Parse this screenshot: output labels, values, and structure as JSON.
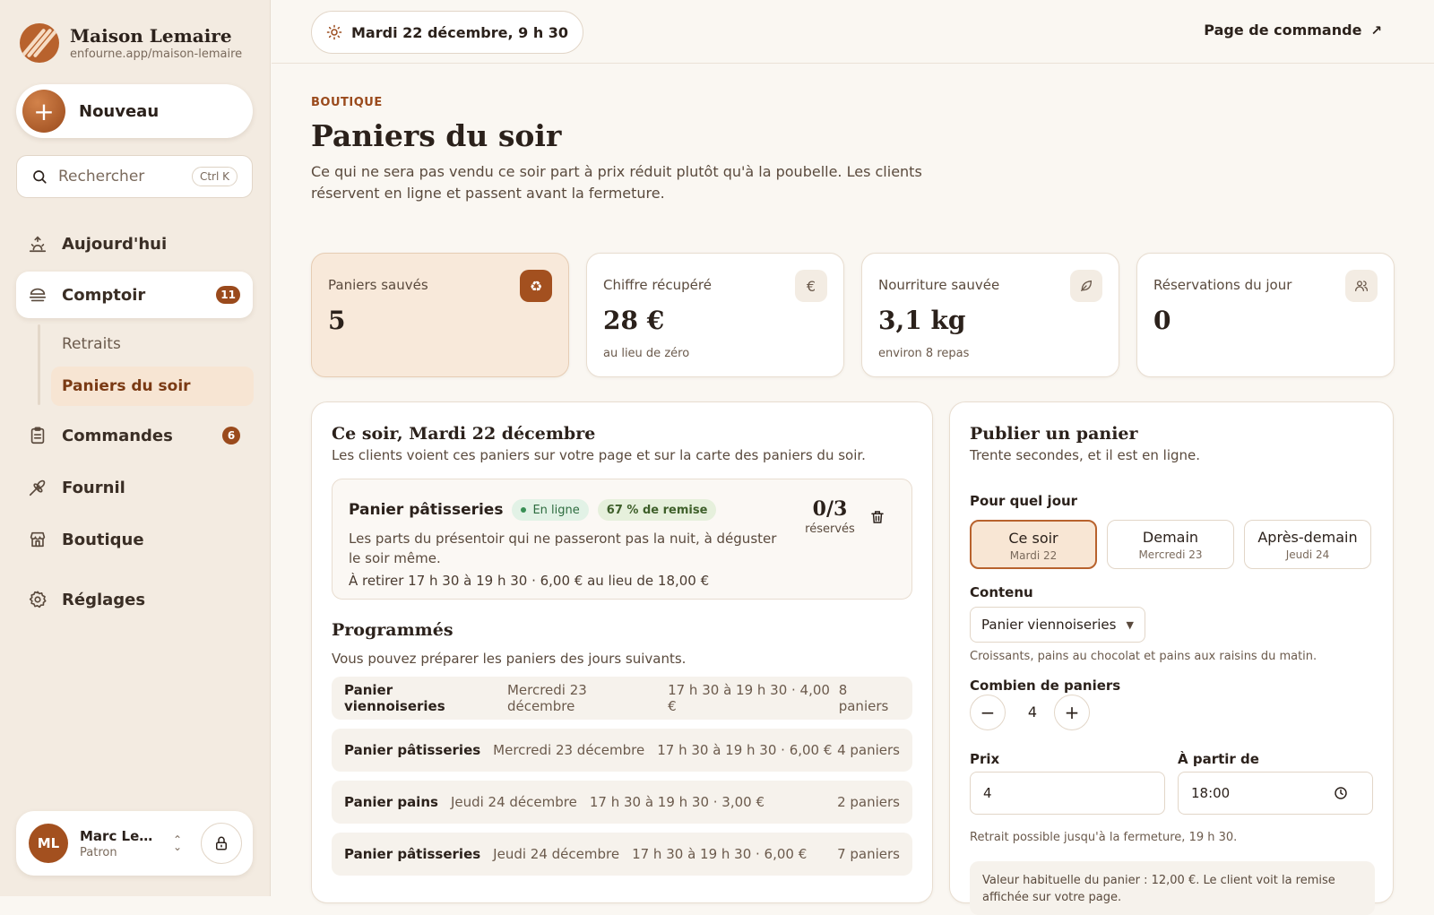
{
  "brand": {
    "name": "Maison Lemaire",
    "url": "enfourne.app/maison-lemaire"
  },
  "sidebar": {
    "new_label": "Nouveau",
    "search_placeholder": "Rechercher",
    "search_shortcut": "Ctrl K",
    "items": [
      {
        "label": "Aujourd'hui",
        "icon": "sunrise-icon"
      },
      {
        "label": "Comptoir",
        "icon": "counter-icon",
        "badge": "11"
      },
      {
        "label": "Commandes",
        "icon": "clipboard-icon",
        "badge": "6"
      },
      {
        "label": "Fournil",
        "icon": "wheat-icon"
      },
      {
        "label": "Boutique",
        "icon": "store-icon"
      },
      {
        "label": "Réglages",
        "icon": "gear-icon"
      }
    ],
    "subitems": [
      "Retraits",
      "Paniers du soir"
    ],
    "user": {
      "initials": "ML",
      "name": "Marc Lem...",
      "role": "Patron"
    }
  },
  "topbar": {
    "date": "Mardi 22 décembre, 9 h 30",
    "order_link": "Page de commande"
  },
  "header": {
    "eyebrow": "BOUTIQUE",
    "title": "Paniers du soir",
    "description": "Ce qui ne sera pas vendu ce soir part à prix réduit plutôt qu'à la poubelle. Les clients réservent en ligne et passent avant la fermeture."
  },
  "stats": [
    {
      "label": "Paniers sauvés",
      "value": "5",
      "sub": "",
      "icon": "recycle-icon"
    },
    {
      "label": "Chiffre récupéré",
      "value": "28 €",
      "sub": "au lieu de zéro",
      "icon": "euro-icon"
    },
    {
      "label": "Nourriture sauvée",
      "value": "3,1 kg",
      "sub": "environ 8 repas",
      "icon": "leaf-icon"
    },
    {
      "label": "Réservations du jour",
      "value": "0",
      "sub": "",
      "icon": "users-icon"
    }
  ],
  "tonight": {
    "title": "Ce soir, Mardi 22 décembre",
    "description": "Les clients voient ces paniers sur votre page et sur la carte des paniers du soir.",
    "basket": {
      "name": "Panier pâtisseries",
      "status": "En ligne",
      "discount": "67 % de remise",
      "description": "Les parts du présentoir qui ne passeront pas la nuit, à déguster le soir même.",
      "pickup": "À retirer 17 h 30 à 19 h 30 · 6,00 € au lieu de 18,00 €",
      "reserved": "0/3",
      "reserved_label": "réservés"
    }
  },
  "scheduled": {
    "title": "Programmés",
    "description": "Vous pouvez préparer les paniers des jours suivants.",
    "rows": [
      {
        "name": "Panier viennoiseries",
        "date": "Mercredi 23 décembre",
        "slot": "17 h 30 à 19 h 30 · 4,00 €",
        "count": "8 paniers"
      },
      {
        "name": "Panier pâtisseries",
        "date": "Mercredi 23 décembre",
        "slot": "17 h 30 à 19 h 30 · 6,00 €",
        "count": "4 paniers"
      },
      {
        "name": "Panier pains",
        "date": "Jeudi 24 décembre",
        "slot": "17 h 30 à 19 h 30 · 3,00 €",
        "count": "2 paniers"
      },
      {
        "name": "Panier pâtisseries",
        "date": "Jeudi 24 décembre",
        "slot": "17 h 30 à 19 h 30 · 6,00 €",
        "count": "7 paniers"
      }
    ]
  },
  "publish": {
    "title": "Publier un panier",
    "description": "Trente secondes, et il est en ligne.",
    "day_label": "Pour quel jour",
    "days": [
      {
        "label": "Ce soir",
        "sub": "Mardi 22"
      },
      {
        "label": "Demain",
        "sub": "Mercredi 23"
      },
      {
        "label": "Après-demain",
        "sub": "Jeudi 24"
      }
    ],
    "content_label": "Contenu",
    "content_value": "Panier viennoiseries",
    "content_hint": "Croissants, pains au chocolat et pains aux raisins du matin.",
    "count_label": "Combien de paniers",
    "count_value": "4",
    "price_label": "Prix",
    "price_value": "4",
    "from_label": "À partir de",
    "from_value": "18:00",
    "pickup_hint": "Retrait possible jusqu'à la fermeture, 19 h 30.",
    "note": "Valeur habituelle du panier : 12,00 €. Le client voit la remise affichée sur votre page."
  },
  "colors": {
    "accent": "#b8622d",
    "accent_dark": "#9a4a1c",
    "background": "#faf7f2",
    "sidebar": "#f3ebe1"
  }
}
